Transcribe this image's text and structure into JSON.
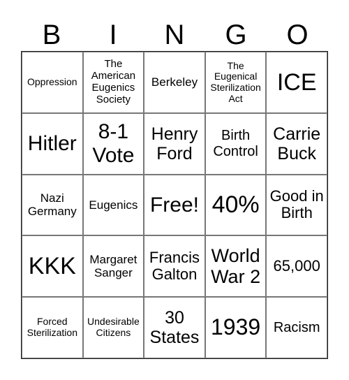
{
  "header": {
    "letters": [
      "B",
      "I",
      "N",
      "G",
      "O"
    ]
  },
  "cells": [
    [
      "Oppression",
      "The American Eugenics Society",
      "Berkeley",
      "The Eugenical Sterilization Act",
      "ICE"
    ],
    [
      "Hitler",
      "8-1 Vote",
      "Henry Ford",
      "Birth Control",
      "Carrie Buck"
    ],
    [
      "Nazi Germany",
      "Eugenics",
      "Free!",
      "40%",
      "Good in Birth"
    ],
    [
      "KKK",
      "Margaret Sanger",
      "Francis Galton",
      "World War 2",
      "65,000"
    ],
    [
      "Forced Sterilization",
      "Undesirable Citizens",
      "30 States",
      "1939",
      "Racism"
    ]
  ]
}
